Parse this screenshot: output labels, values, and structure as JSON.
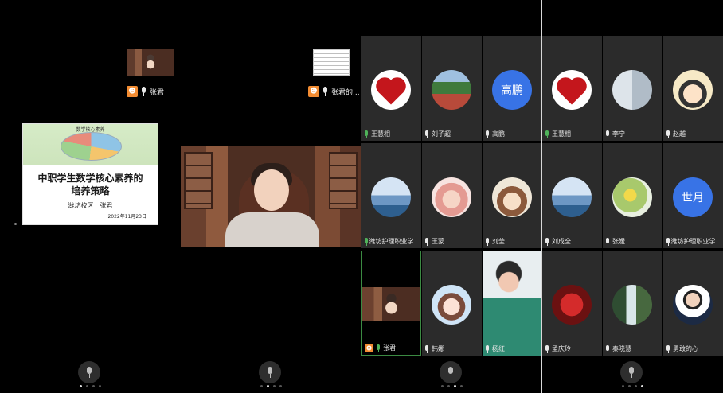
{
  "panel1": {
    "self_thumb_name": "张君",
    "slide": {
      "header_label": "数学核心素养",
      "title_line1": "中职学生数学核心素养的",
      "title_line2": "培养策略",
      "author": "潍坊校区　张君",
      "date": "2022年11月23日"
    }
  },
  "panel2": {
    "doc_thumb_name": "张君的..."
  },
  "grid1": [
    {
      "name": "王慧相",
      "avatar": "heart",
      "mic": "green"
    },
    {
      "name": "刘子超",
      "avatar": "field",
      "mic": "white"
    },
    {
      "name": "高鹏",
      "avatar": "text",
      "avatar_text": "高鹏",
      "mic": "white"
    },
    {
      "name": "潍坊护理职业学...",
      "avatar": "lake",
      "mic": "green"
    },
    {
      "name": "王蒙",
      "avatar": "girl-pink",
      "mic": "white"
    },
    {
      "name": "刘莹",
      "avatar": "girl-hat",
      "mic": "white"
    },
    {
      "name": "张君",
      "avatar": "video",
      "mic": "green",
      "host": true,
      "active": true
    },
    {
      "name": "韩娜",
      "avatar": "doll",
      "mic": "white"
    },
    {
      "name": "杨红",
      "avatar": "camera",
      "mic": "white"
    }
  ],
  "grid2": [
    {
      "name": "王慧相",
      "avatar": "heart",
      "mic": "green"
    },
    {
      "name": "李宁",
      "avatar": "winter",
      "mic": "white"
    },
    {
      "name": "赵越",
      "avatar": "cartoon",
      "mic": "white"
    },
    {
      "name": "刘成全",
      "avatar": "lake",
      "mic": "white"
    },
    {
      "name": "张媛",
      "avatar": "flowers",
      "mic": "white"
    },
    {
      "name": "潍坊护理职业学...",
      "avatar": "text",
      "avatar_text": "世月",
      "mic": "white"
    },
    {
      "name": "孟庆玲",
      "avatar": "lantern",
      "mic": "white"
    },
    {
      "name": "秦晓慧",
      "avatar": "waterfall",
      "mic": "white"
    },
    {
      "name": "勇敢的心",
      "avatar": "man",
      "mic": "white"
    }
  ],
  "colors": {
    "host_badge": "#f38c32",
    "mic_active": "#4fb35a",
    "divider": "#d8d8d8",
    "cell_bg": "#2b2b2b"
  }
}
